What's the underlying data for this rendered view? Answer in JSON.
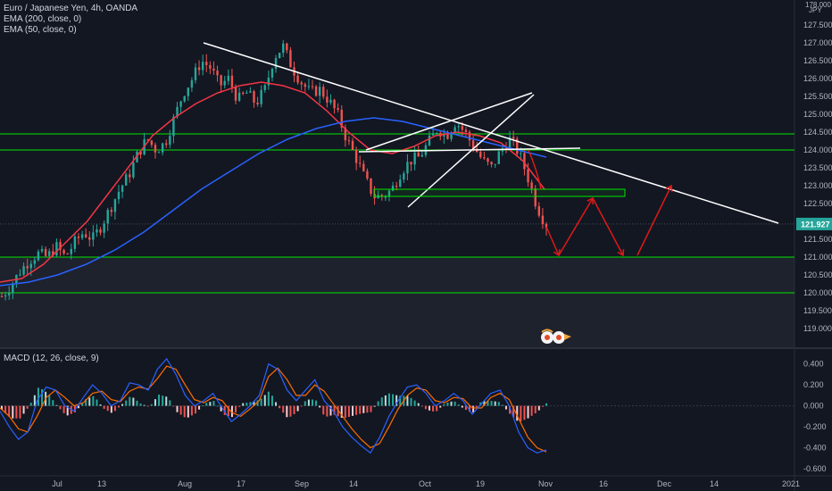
{
  "legend": {
    "symbol": "Euro / Japanese Yen, 4h, OANDA",
    "ema200": "EMA (200, close, 0)",
    "ema50": "EMA (50, close, 0)",
    "macd": "MACD (12, 26, close, 9)"
  },
  "axis": {
    "top_label": "178.000",
    "currency": "JPY",
    "last_price": "121.927"
  },
  "colors": {
    "background": "#131722",
    "candle_up": "#26a69a",
    "candle_down": "#ef5350",
    "ema200": "#2962ff",
    "ema50": "#f23645",
    "zone_lines": "#00e500",
    "trendlines": "#ffffff",
    "projection": "#e01818",
    "macd_line": "#2962ff",
    "signal_line": "#ff6d00"
  },
  "chart_data": [
    {
      "type": "candlestick",
      "y_ticks": [
        "127.500",
        "127.000",
        "126.500",
        "126.000",
        "125.500",
        "125.000",
        "124.500",
        "124.000",
        "123.500",
        "123.000",
        "122.500",
        "122.000",
        "121.500",
        "121.000",
        "120.500",
        "120.000",
        "119.500",
        "119.000"
      ],
      "x_ticks": [
        "Jul",
        "13",
        "Aug",
        "17",
        "Sep",
        "14",
        "Oct",
        "19",
        "Nov",
        "16",
        "Dec",
        "14",
        "2021"
      ],
      "ylim": [
        118.6,
        127.9
      ],
      "last_price": 121.927,
      "horizontal_levels": [
        124.45,
        124.0,
        121.0,
        120.0
      ],
      "zone": {
        "x": [
          "Sep 21",
          "Oct 30 +2w"
        ],
        "y": [
          122.7,
          122.9
        ]
      },
      "trendlines": [
        {
          "from": [
            "Aug 1",
            127.0
          ],
          "to": [
            "Dec 28",
            121.95
          ]
        },
        {
          "from": [
            "Sep 19",
            123.95
          ],
          "to": [
            "Nov 15",
            124.05
          ]
        },
        {
          "from": [
            "Sep 22",
            122.4
          ],
          "to": [
            "Oct 29",
            125.55
          ]
        },
        {
          "from": [
            "Sep 19",
            124.0
          ],
          "to": [
            "Oct 28",
            125.6
          ]
        }
      ],
      "projection_path": [
        [
          121.85,
          121.05
        ],
        [
          121.05,
          122.65
        ],
        [
          122.65,
          121.05
        ],
        [
          121.05,
          123.0
        ]
      ],
      "price_path": [
        119.9,
        120.2,
        120.6,
        120.9,
        121.1,
        121.0,
        121.3,
        121.0,
        121.4,
        121.7,
        121.5,
        121.9,
        122.4,
        122.9,
        123.3,
        123.9,
        124.3,
        124.0,
        124.2,
        124.9,
        125.6,
        126.0,
        126.5,
        126.3,
        125.8,
        126.0,
        125.4,
        125.6,
        125.3,
        125.7,
        126.6,
        126.9,
        126.3,
        125.9,
        125.6,
        125.7,
        125.4,
        125.0,
        124.3,
        123.8,
        123.2,
        122.7,
        122.7,
        122.9,
        123.4,
        123.7,
        123.8,
        124.2,
        124.6,
        124.4,
        124.8,
        124.5,
        124.1,
        123.7,
        123.5,
        124.0,
        124.3,
        123.9,
        123.2,
        122.4,
        121.9
      ],
      "ema50_path": [
        120.3,
        120.4,
        120.8,
        121.4,
        122.0,
        122.8,
        123.6,
        124.4,
        124.9,
        125.3,
        125.6,
        125.8,
        125.9,
        125.8,
        125.6,
        125.1,
        124.5,
        124.0,
        123.9,
        124.1,
        124.4,
        124.5,
        124.4,
        124.2,
        123.7,
        122.9
      ],
      "ema200_path": [
        120.2,
        120.3,
        120.5,
        120.8,
        121.2,
        121.7,
        122.3,
        122.9,
        123.4,
        123.9,
        124.3,
        124.6,
        124.8,
        124.9,
        124.8,
        124.6,
        124.4,
        124.2,
        124.0,
        123.8
      ]
    },
    {
      "type": "macd",
      "y_ticks": [
        "0.400",
        "0.200",
        "0.000",
        "-0.200",
        "-0.400",
        "-0.600"
      ],
      "ylim": [
        -0.66,
        0.5
      ],
      "macd_path": [
        -0.05,
        -0.2,
        -0.32,
        -0.25,
        0.05,
        0.18,
        0.15,
        0.0,
        -0.05,
        0.08,
        0.2,
        0.12,
        0.0,
        0.05,
        0.22,
        0.2,
        0.15,
        0.35,
        0.45,
        0.3,
        0.1,
        0.0,
        0.05,
        0.12,
        -0.02,
        -0.15,
        -0.08,
        0.0,
        0.1,
        0.4,
        0.35,
        0.15,
        0.05,
        0.15,
        0.25,
        0.05,
        -0.05,
        -0.2,
        -0.3,
        -0.38,
        -0.45,
        -0.3,
        -0.1,
        0.05,
        0.18,
        0.2,
        0.12,
        0.0,
        0.05,
        0.12,
        0.05,
        -0.08,
        0.02,
        0.12,
        0.15,
        0.0,
        -0.25,
        -0.4,
        -0.45,
        -0.42
      ],
      "signal_path": [
        -0.02,
        -0.1,
        -0.22,
        -0.25,
        -0.1,
        0.08,
        0.15,
        0.08,
        0.0,
        0.03,
        0.12,
        0.14,
        0.06,
        0.04,
        0.14,
        0.18,
        0.16,
        0.26,
        0.38,
        0.35,
        0.2,
        0.06,
        0.03,
        0.08,
        0.05,
        -0.06,
        -0.1,
        -0.03,
        0.05,
        0.28,
        0.36,
        0.25,
        0.1,
        0.1,
        0.2,
        0.14,
        0.02,
        -0.1,
        -0.22,
        -0.32,
        -0.4,
        -0.36,
        -0.2,
        -0.03,
        0.1,
        0.17,
        0.15,
        0.05,
        0.03,
        0.08,
        0.07,
        -0.02,
        -0.02,
        0.08,
        0.12,
        0.06,
        -0.12,
        -0.3,
        -0.4,
        -0.44
      ]
    }
  ]
}
